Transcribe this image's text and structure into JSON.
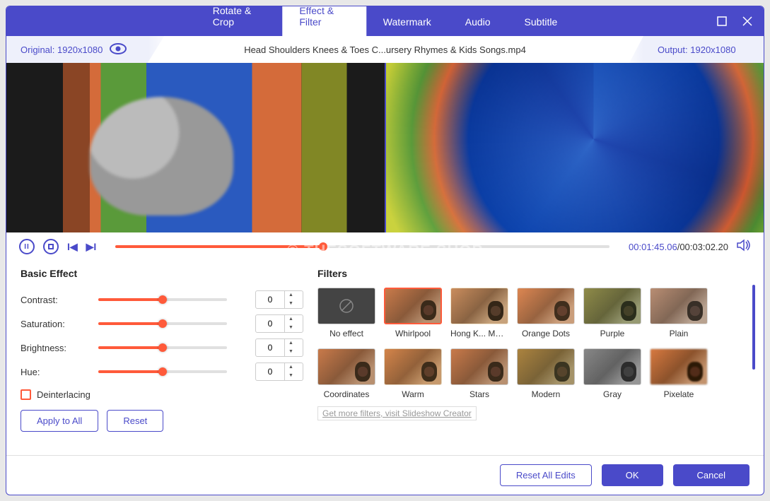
{
  "tabs": {
    "rotate": "Rotate & Crop",
    "effect": "Effect & Filter",
    "watermark": "Watermark",
    "audio": "Audio",
    "subtitle": "Subtitle"
  },
  "info": {
    "original_label": "Original: 1920x1080",
    "filename": "Head Shoulders Knees & Toes  C...ursery Rhymes & Kids Songs.mp4",
    "output_label": "Output: 1920x1080"
  },
  "watermark_text": "© THESOFTWARE.SHOP",
  "playback": {
    "current": "00:01:45.06",
    "total": "/00:03:02.20"
  },
  "basic_effect": {
    "title": "Basic Effect",
    "contrast_label": "Contrast:",
    "contrast_val": "0",
    "saturation_label": "Saturation:",
    "saturation_val": "0",
    "brightness_label": "Brightness:",
    "brightness_val": "0",
    "hue_label": "Hue:",
    "hue_val": "0",
    "deinterlacing": "Deinterlacing",
    "apply_all": "Apply to All",
    "reset": "Reset"
  },
  "filters": {
    "title": "Filters",
    "items": [
      "No effect",
      "Whirlpool",
      "Hong K... Movie",
      "Orange Dots",
      "Purple",
      "Plain",
      "Coordinates",
      "Warm",
      "Stars",
      "Modern",
      "Gray",
      "Pixelate"
    ],
    "more": "Get more filters, visit Slideshow Creator"
  },
  "footer": {
    "reset_all": "Reset All Edits",
    "ok": "OK",
    "cancel": "Cancel"
  },
  "colors": {
    "accent": "#4a4ac9",
    "slider": "#ff5a3a"
  }
}
